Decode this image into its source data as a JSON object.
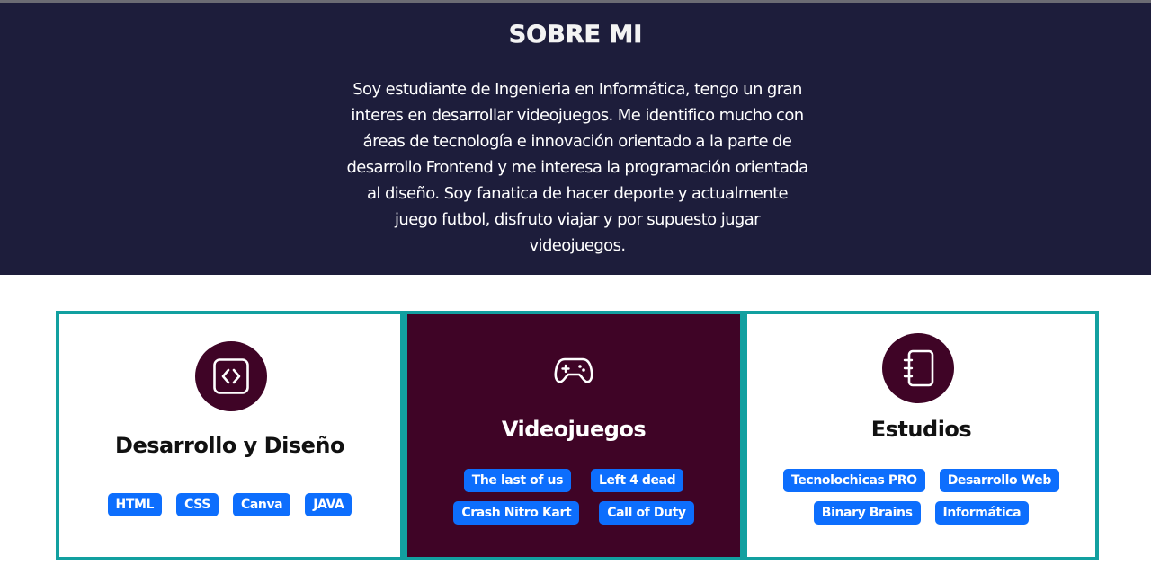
{
  "about": {
    "title": "SOBRE MI",
    "text": "Soy estudiante de Ingenieria en Informática, tengo un gran interes en desarrollar videojuegos. Me identifico mucho con áreas de tecnología e innovación orientado a la parte de desarrollo Frontend y me interesa la programación orientada al diseño. Soy fanatica de hacer deporte y actualmente juego futbol, disfruto viajar y por supuesto jugar videojuegos."
  },
  "cards": [
    {
      "icon": "code-icon",
      "title": "Desarrollo y Diseño",
      "tags": [
        "HTML",
        "CSS",
        "Canva",
        "JAVA"
      ]
    },
    {
      "icon": "gamepad-icon",
      "title": "Videojuegos",
      "tags": [
        "The last of us",
        "Left 4 dead",
        "Crash Nitro Kart",
        "Call of Duty"
      ]
    },
    {
      "icon": "notebook-icon",
      "title": "Estudios",
      "tags": [
        "Tecnolochicas PRO",
        "Desarrollo Web",
        "Binary Brains",
        "Informática"
      ]
    }
  ],
  "colors": {
    "header_bg": "#1d1d3b",
    "accent_dark": "#3f0426",
    "border_teal": "#12a0a0",
    "tag_blue": "#0d6efd"
  }
}
